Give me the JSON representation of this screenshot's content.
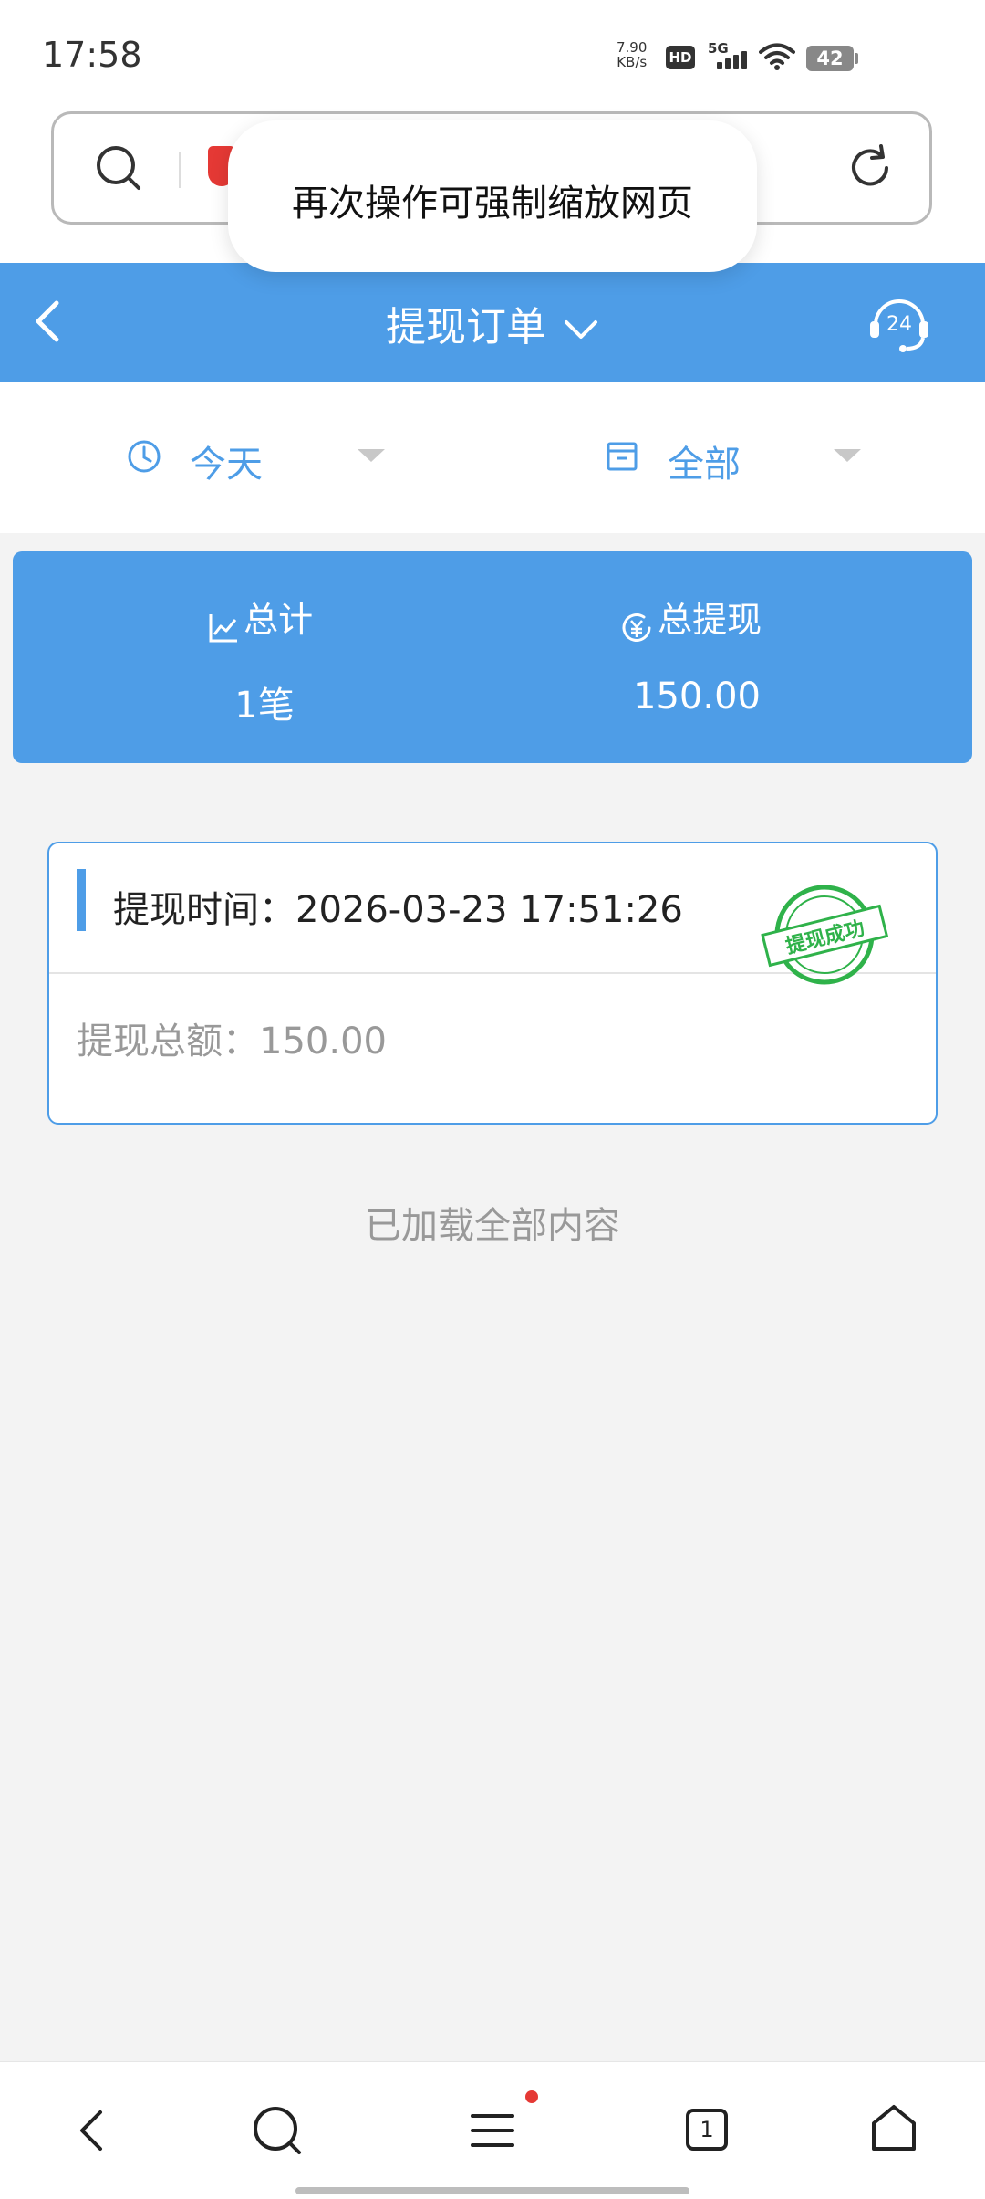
{
  "status_bar": {
    "time": "17:58",
    "net_speed_value": "7.90",
    "net_speed_unit": "KB/s",
    "hd": "HD",
    "network": "5G",
    "battery": "42"
  },
  "toast": {
    "text": "再次操作可强制缩放网页"
  },
  "header": {
    "title": "提现订单"
  },
  "support": {
    "badge": "24"
  },
  "filters": {
    "date": "今天",
    "type": "全部"
  },
  "summary": {
    "total_label": "总计",
    "total_value": "1笔",
    "withdraw_label": "总提现",
    "withdraw_value": "150.00"
  },
  "orders": [
    {
      "time_label": "提现时间：",
      "time": "2026-03-23 17:51:26",
      "amount_label": "提现总额：",
      "amount": "150.00",
      "status_stamp": "提现成功"
    }
  ],
  "footer": {
    "loaded_all": "已加载全部内容"
  },
  "bottom_nav": {
    "tabs_count": "1"
  },
  "colors": {
    "accent": "#4e9de7",
    "stamp_green": "#2fb24a"
  }
}
